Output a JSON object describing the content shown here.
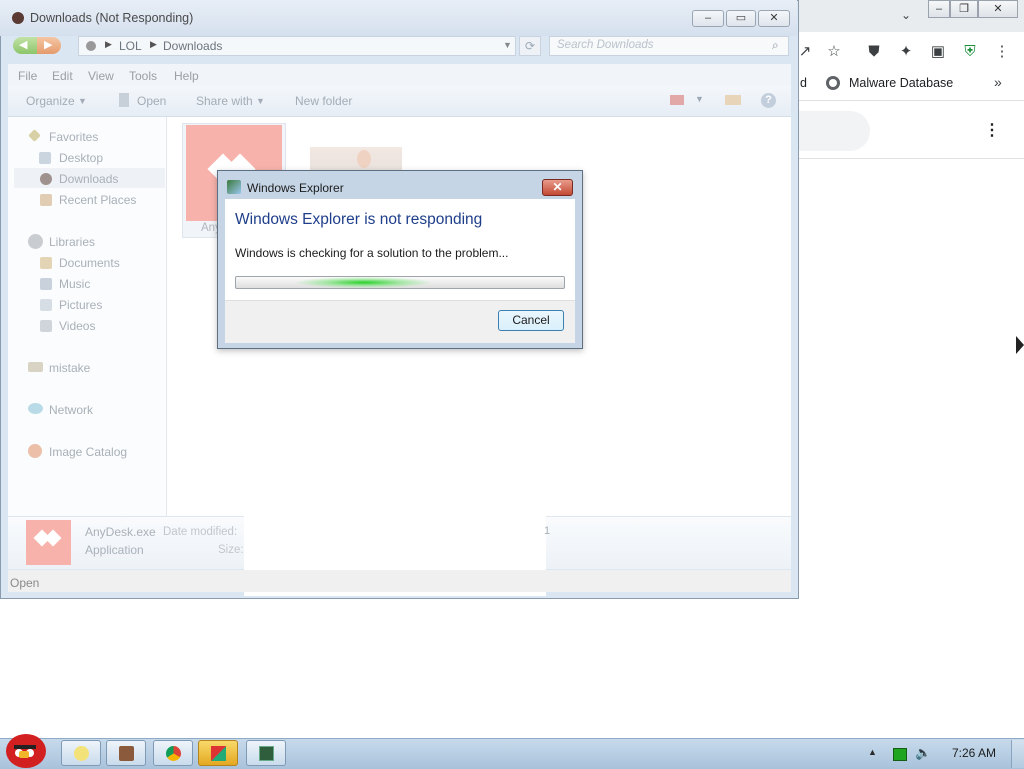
{
  "chrome": {
    "bookmark_partial": "d",
    "bookmark_malware": "Malware Database",
    "more_bookmarks": "»"
  },
  "explorer": {
    "title": "Downloads (Not Responding)",
    "address": {
      "crumbs": [
        "LOL",
        "Downloads"
      ]
    },
    "search_placeholder": "Search Downloads",
    "menu": [
      "File",
      "Edit",
      "View",
      "Tools",
      "Help"
    ],
    "commands": {
      "organize": "Organize",
      "open": "Open",
      "share_with": "Share with",
      "new_folder": "New folder"
    },
    "nav": {
      "favorites": "Favorites",
      "desktop": "Desktop",
      "downloads": "Downloads",
      "recent": "Recent Places",
      "libraries": "Libraries",
      "documents": "Documents",
      "music": "Music",
      "pictures": "Pictures",
      "videos": "Videos",
      "mistake": "mistake",
      "network": "Network",
      "image_catalog": "Image Catalog"
    },
    "file_label_partial": "Any",
    "details": {
      "name": "AnyDesk.exe",
      "type": "Application",
      "date_label": "Date modified:",
      "size_label": "Size:",
      "trailing": "1"
    },
    "status": "Open"
  },
  "dialog": {
    "title": "Windows Explorer",
    "heading": "Windows Explorer is not responding",
    "message": "Windows is checking for a solution to the problem...",
    "cancel": "Cancel"
  },
  "taskbar": {
    "clock": "7:26 AM"
  },
  "colors": {
    "accent_heading": "#1e3e8a",
    "anydesk": "#f8b2ac",
    "progress_glow": "#2bd12b",
    "taskbar": "#bcd2e8",
    "active_task": "#f0c040"
  }
}
